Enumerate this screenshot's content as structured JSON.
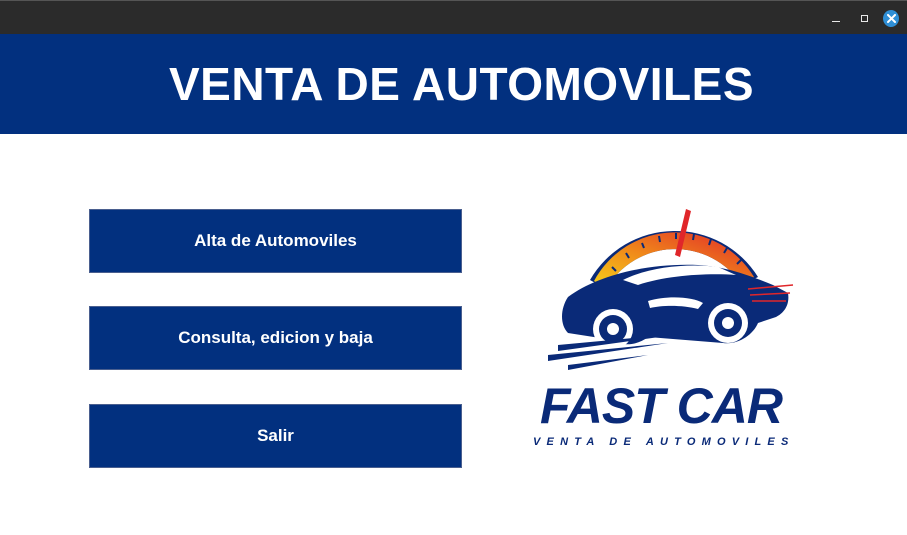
{
  "window": {
    "controls": {
      "minimize_icon": "minimize-icon",
      "maximize_icon": "maximize-icon",
      "close_icon": "close-icon"
    }
  },
  "header": {
    "title": "VENTA DE AUTOMOVILES",
    "background": "#02307f"
  },
  "menu": {
    "alta_label": "Alta de Automoviles",
    "consulta_label": "Consulta, edicion y baja",
    "salir_label": "Salir"
  },
  "logo": {
    "brand": "FAST CAR",
    "tagline": "VENTA DE AUTOMOVILES",
    "icon": "car-speedometer-logo",
    "colors": {
      "navy": "#0a2a78",
      "red": "#e0262a",
      "orange": "#f08a1a",
      "yellow": "#f6d21a"
    }
  }
}
